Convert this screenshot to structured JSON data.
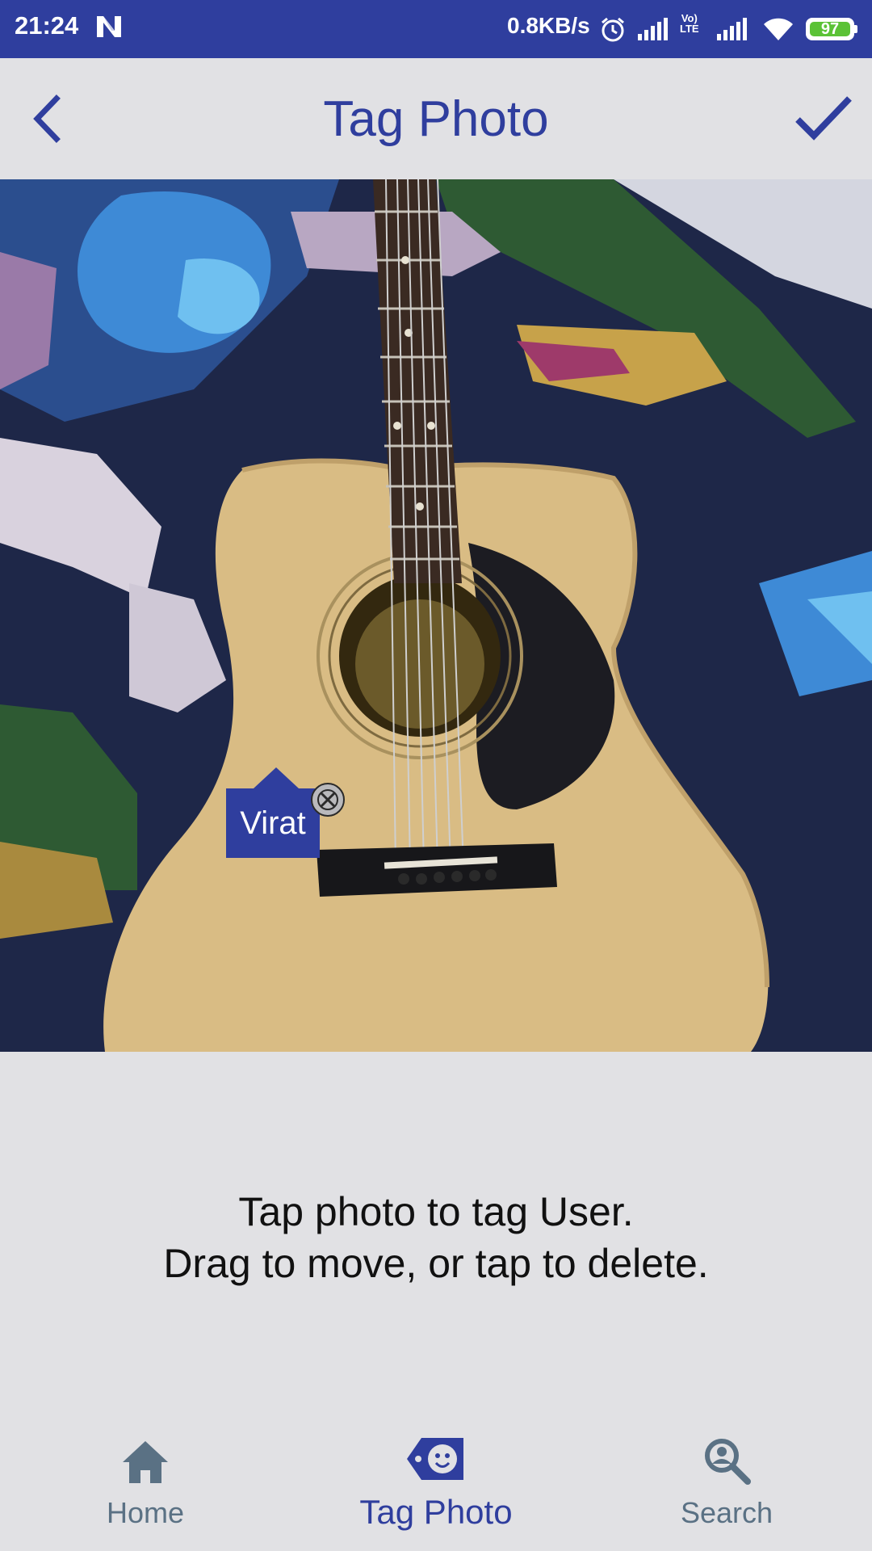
{
  "status_bar": {
    "time": "21:24",
    "network_speed": "0.8KB/s",
    "volte_top": "Vo)",
    "volte_bottom": "LTE",
    "battery": "97"
  },
  "app_bar": {
    "title": "Tag Photo",
    "back_icon": "chevron-left-icon",
    "confirm_icon": "check-icon"
  },
  "photo": {
    "tags": [
      {
        "label": "Virat"
      }
    ]
  },
  "instructions": {
    "line1": "Tap photo to tag User.",
    "line2": "Drag to move, or tap to delete."
  },
  "bottom_nav": {
    "items": [
      {
        "label": "Home",
        "icon": "home-icon",
        "active": false
      },
      {
        "label": "Tag Photo",
        "icon": "tag-face-icon",
        "active": true
      },
      {
        "label": "Search",
        "icon": "search-person-icon",
        "active": false
      }
    ]
  },
  "colors": {
    "primary": "#2F3E9E",
    "background": "#E1E1E4",
    "inactive_nav": "#5A7184",
    "battery_fill": "#5BC236"
  }
}
